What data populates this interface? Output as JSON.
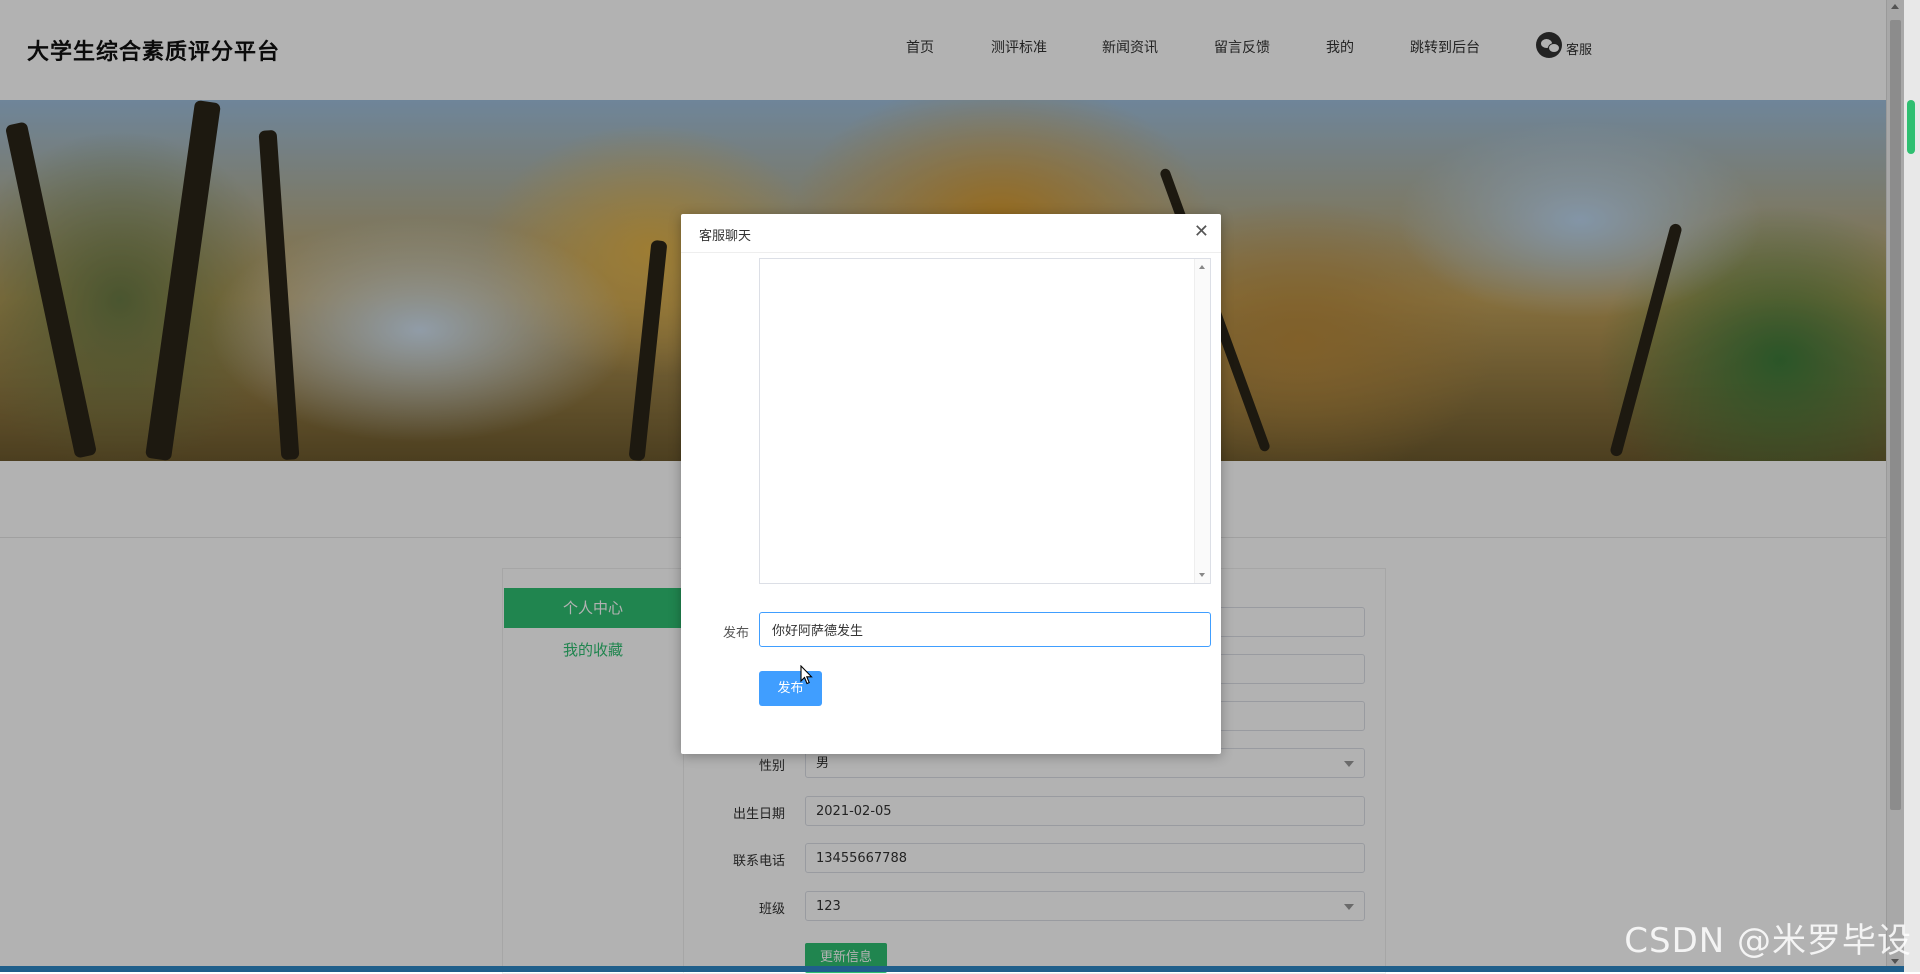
{
  "site": {
    "title": "大学生综合素质评分平台"
  },
  "nav": {
    "items": [
      "首页",
      "测评标准",
      "新闻资讯",
      "留言反馈",
      "我的",
      "跳转到后台"
    ],
    "service_label": "客服",
    "service_icon": "wechat-icon"
  },
  "sidebar": {
    "active": "个人中心",
    "items": [
      "我的收藏"
    ]
  },
  "form": {
    "fields": [
      {
        "label": "性别",
        "value": "男",
        "type": "select"
      },
      {
        "label": "出生日期",
        "value": "2021-02-05",
        "type": "input"
      },
      {
        "label": "联系电话",
        "value": "13455667788",
        "type": "input"
      },
      {
        "label": "班级",
        "value": "123",
        "type": "select"
      }
    ],
    "update_label": "更新信息"
  },
  "dialog": {
    "title": "客服聊天",
    "close_icon": "close-icon",
    "post_label": "发布",
    "post_value": "你好阿萨德发生",
    "post_button": "发布"
  },
  "watermark": "CSDN @米罗毕设",
  "colors": {
    "accent_green": "#2fbf71",
    "primary_blue": "#409eff",
    "overlay": "rgba(0,0,0,0.3)"
  }
}
